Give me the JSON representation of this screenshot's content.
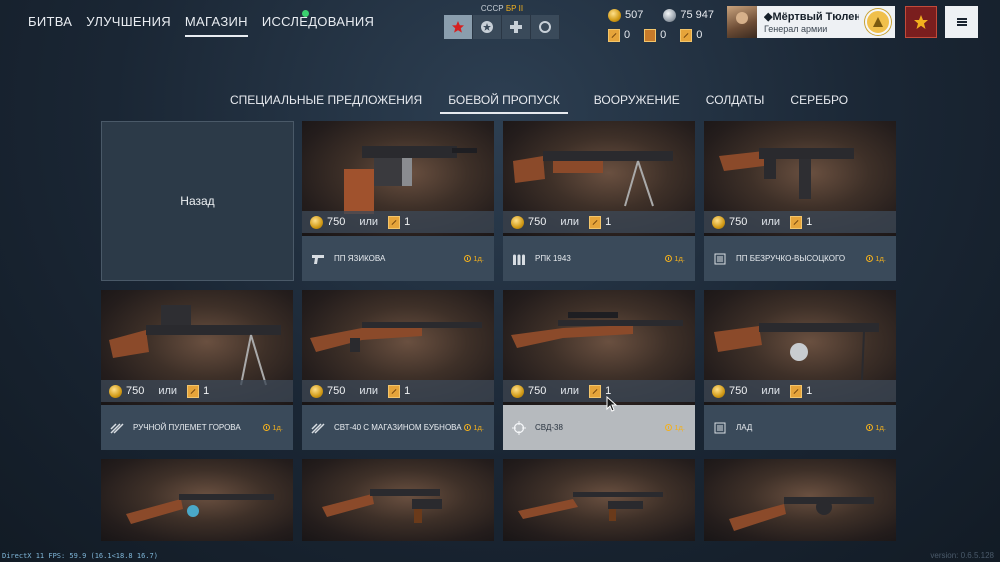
{
  "mainnav": {
    "items": [
      {
        "label": "БИТВА"
      },
      {
        "label": "УЛУЧШЕНИЯ"
      },
      {
        "label": "МАГАЗИН"
      },
      {
        "label": "ИССЛЕДОВАНИЯ"
      }
    ],
    "active_index": 2
  },
  "nation": {
    "label": "СССР",
    "br": "БР II",
    "icons": [
      "star-icon",
      "ussr-emblem-icon",
      "cross-icon",
      "circle-icon"
    ]
  },
  "currency": {
    "gold": "507",
    "silver": "75 947",
    "ticket_1": "0",
    "ticket_2": "0",
    "ticket_3": "0"
  },
  "profile": {
    "name": "◆Мёртвый Тюлень",
    "rank": "Генерал армии"
  },
  "shoptabs": {
    "items": [
      {
        "label": "СПЕЦИАЛЬНЫЕ ПРЕДЛОЖЕНИЯ"
      },
      {
        "label": "БОЕВОЙ ПРОПУСК"
      },
      {
        "label": "ВООРУЖЕНИЕ"
      },
      {
        "label": "СОЛДАТЫ"
      },
      {
        "label": "СЕРЕБРО"
      }
    ],
    "active_index": 1
  },
  "back_label": "Назад",
  "cards": [
    {
      "price": "750",
      "or": "или",
      "tickets": "1",
      "name": "ПП ЯЗИКОВА",
      "time": "1д.",
      "icon": "pistol-icon"
    },
    {
      "price": "750",
      "or": "или",
      "tickets": "1",
      "name": "РПК 1943",
      "time": "1д.",
      "icon": "ammo-icon"
    },
    {
      "price": "750",
      "or": "или",
      "tickets": "1",
      "name": "ПП БЕЗРУЧКО-ВЫСОЦКОГО",
      "time": "1д.",
      "icon": "magazine-icon"
    },
    {
      "price": "750",
      "or": "или",
      "tickets": "1",
      "name": "РУЧНОЙ ПУЛЕМЕТ ГОРОВА",
      "time": "1д.",
      "icon": "machinegun-icon"
    },
    {
      "price": "750",
      "or": "или",
      "tickets": "1",
      "name": "СВТ-40 С МАГАЗИНОМ БУБНОВА",
      "time": "1д.",
      "icon": "machinegun-icon"
    },
    {
      "price": "750",
      "or": "или",
      "tickets": "1",
      "name": "СВД-38",
      "time": "1д.",
      "icon": "scope-icon"
    },
    {
      "price": "750",
      "or": "или",
      "tickets": "1",
      "name": "ЛАД",
      "time": "1д.",
      "icon": "magazine-icon"
    }
  ],
  "debug": "DirectX 11 FPS: 59.9 (16.1<18.8 16.7)",
  "version": "version: 0.6.5.128"
}
